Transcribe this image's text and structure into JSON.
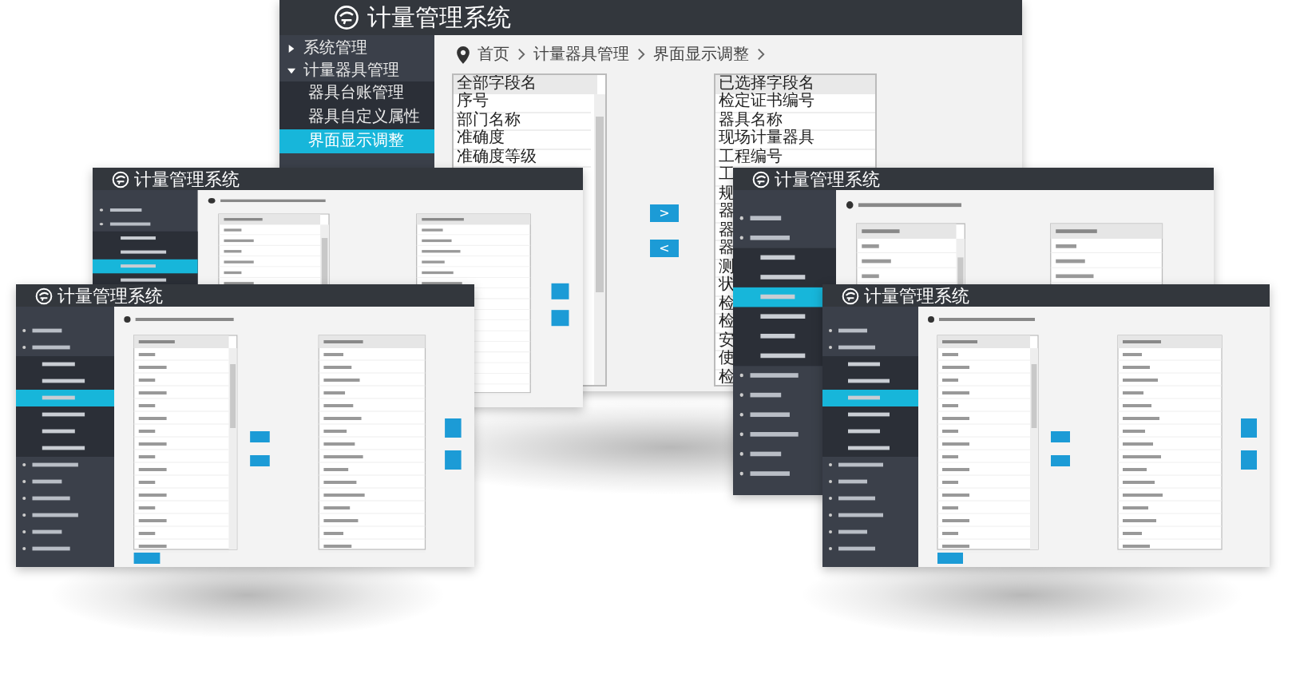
{
  "windows": [
    {
      "kind": "detailed",
      "title": "计量管理系统",
      "sidebar": [
        {
          "label": "系统管理",
          "expanded": false,
          "selected": false
        },
        {
          "label": "计量器具管理",
          "expanded": true,
          "selected": false,
          "children": [
            {
              "label": "器具台账管理",
              "selected": false
            },
            {
              "label": "器具自定义属性",
              "selected": false
            },
            {
              "label": "界面显示调整",
              "selected": true
            }
          ]
        }
      ],
      "breadcrumb": [
        "首页",
        "计量器具管理",
        "界面显示调整"
      ],
      "all_fields": {
        "header": "全部字段名",
        "items": [
          "序号",
          "部门名称",
          "准确度",
          "准确度等级"
        ]
      },
      "selected_fields": {
        "header": "已选择字段名",
        "items": [
          "检定证书编号",
          "器具名称",
          "现场计量器具",
          "工程编号",
          "工",
          "规",
          "器",
          "器",
          "器",
          "测",
          "状",
          "检",
          "检",
          "安",
          "使",
          "检"
        ]
      },
      "move_buttons": [
        ">",
        "<"
      ]
    },
    {
      "kind": "thumbnail",
      "title": "计量管理系统"
    },
    {
      "kind": "thumbnail",
      "title": "计量管理系统"
    },
    {
      "kind": "thumbnail",
      "title": "计量管理系统"
    },
    {
      "kind": "thumbnail",
      "title": "计量管理系统"
    }
  ]
}
